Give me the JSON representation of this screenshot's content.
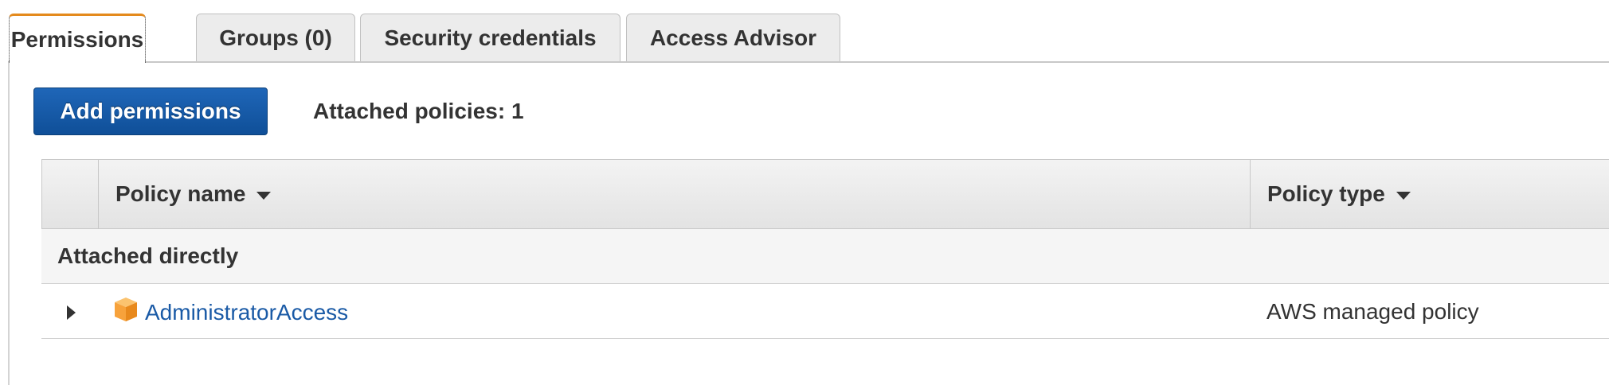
{
  "tabs": [
    {
      "label": "Permissions",
      "active": true
    },
    {
      "label": "Groups (0)",
      "active": false
    },
    {
      "label": "Security credentials",
      "active": false
    },
    {
      "label": "Access Advisor",
      "active": false
    }
  ],
  "toolbar": {
    "add_permissions_label": "Add permissions",
    "attached_count_text": "Attached policies: 1"
  },
  "table": {
    "columns": {
      "policy_name": "Policy name",
      "policy_type": "Policy type"
    },
    "groups": [
      {
        "label": "Attached directly",
        "rows": [
          {
            "name": "AdministratorAccess",
            "type": "AWS managed policy",
            "icon": "aws-managed-policy-cube-icon"
          }
        ]
      }
    ]
  },
  "colors": {
    "active_tab_accent": "#e48a1d",
    "primary_button": "#1a5aa6",
    "link": "#1a5aa6",
    "managed_policy_icon": "#f7a23b"
  }
}
